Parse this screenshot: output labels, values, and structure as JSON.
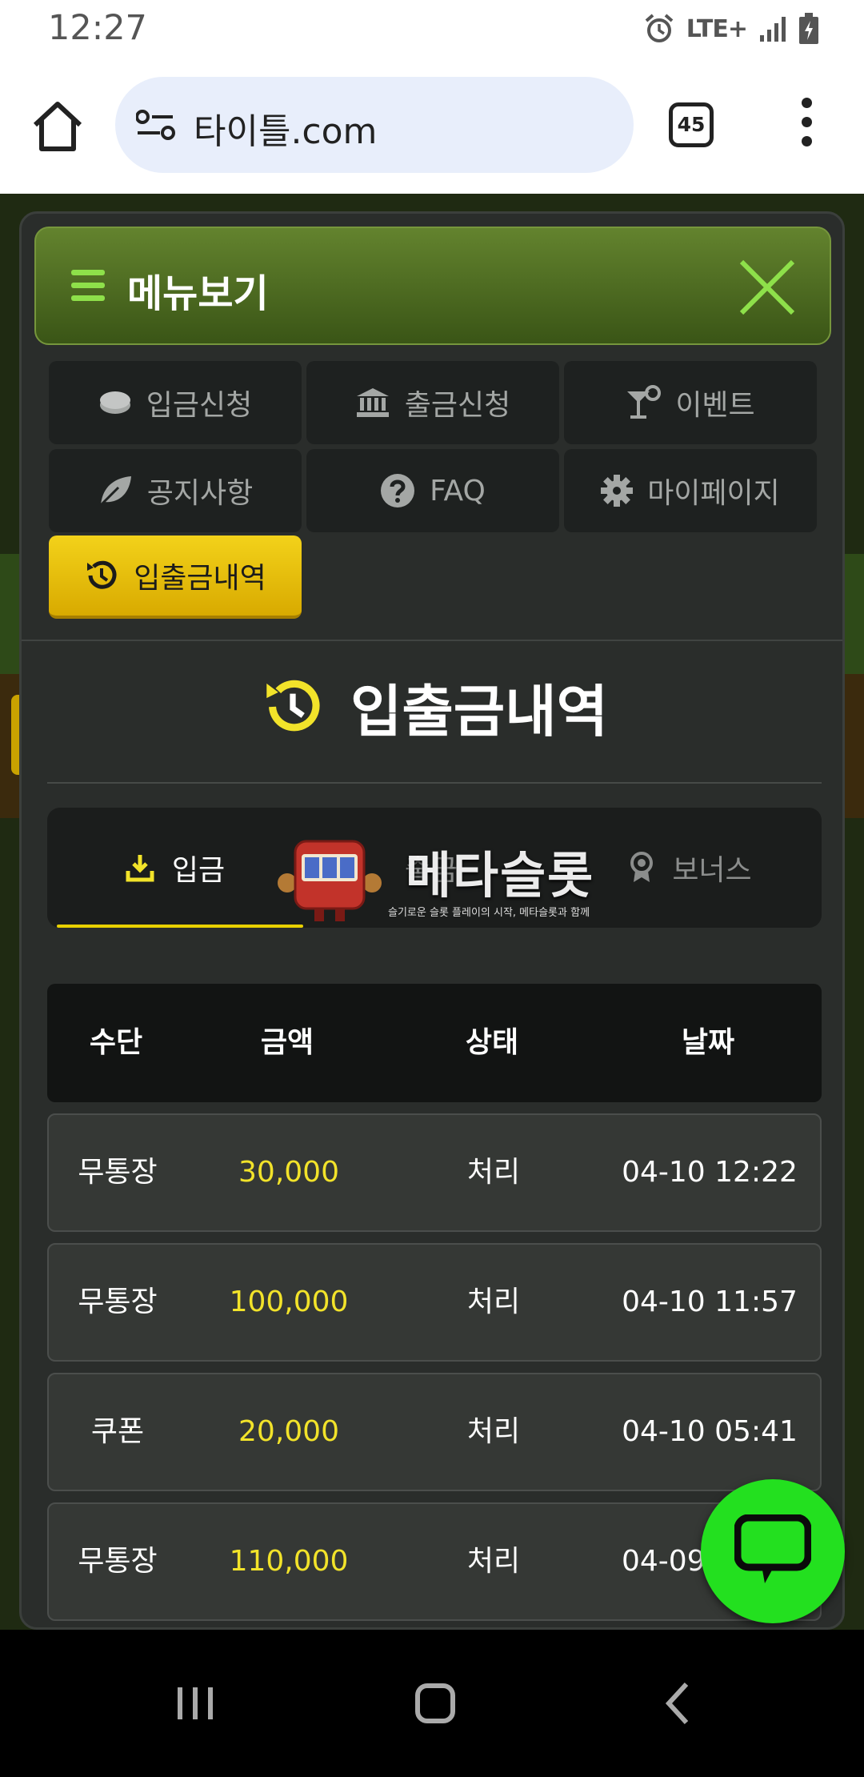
{
  "status_bar": {
    "time": "12:27",
    "network": "LTE+"
  },
  "browser": {
    "url": "타이틀.com",
    "tab_count": "45"
  },
  "menu": {
    "title": "메뉴보기",
    "items": [
      {
        "label": "입금신청",
        "icon": "coin-icon"
      },
      {
        "label": "출금신청",
        "icon": "bank-icon"
      },
      {
        "label": "이벤트",
        "icon": "cocktail-icon"
      },
      {
        "label": "공지사항",
        "icon": "leaf-icon"
      },
      {
        "label": "FAQ",
        "icon": "question-icon"
      },
      {
        "label": "마이페이지",
        "icon": "gear-icon"
      },
      {
        "label": "입출금내역",
        "icon": "history-icon",
        "active": true
      }
    ]
  },
  "content": {
    "title": "입출금내역",
    "tabs": [
      {
        "label": "입금",
        "active": true
      },
      {
        "label": "출금",
        "active": false
      },
      {
        "label": "보너스",
        "active": false
      }
    ],
    "watermark": {
      "title": "메타슬롯",
      "subtitle": "슬기로운 슬롯 플레이의 시작, 메타슬롯과 함께"
    },
    "table": {
      "headers": [
        "수단",
        "금액",
        "상태",
        "날짜"
      ],
      "rows": [
        {
          "method": "무통장",
          "amount": "30,000",
          "status": "처리",
          "date": "04-10 12:22"
        },
        {
          "method": "무통장",
          "amount": "100,000",
          "status": "처리",
          "date": "04-10 11:57"
        },
        {
          "method": "쿠폰",
          "amount": "20,000",
          "status": "처리",
          "date": "04-10 05:41"
        },
        {
          "method": "무통장",
          "amount": "110,000",
          "status": "처리",
          "date": "04-09"
        }
      ]
    }
  },
  "colors": {
    "accent_yellow": "#f2e32a",
    "header_green": "#4d6b22",
    "chat_green": "#23e01f",
    "panel_bg": "#2a2d2b"
  }
}
